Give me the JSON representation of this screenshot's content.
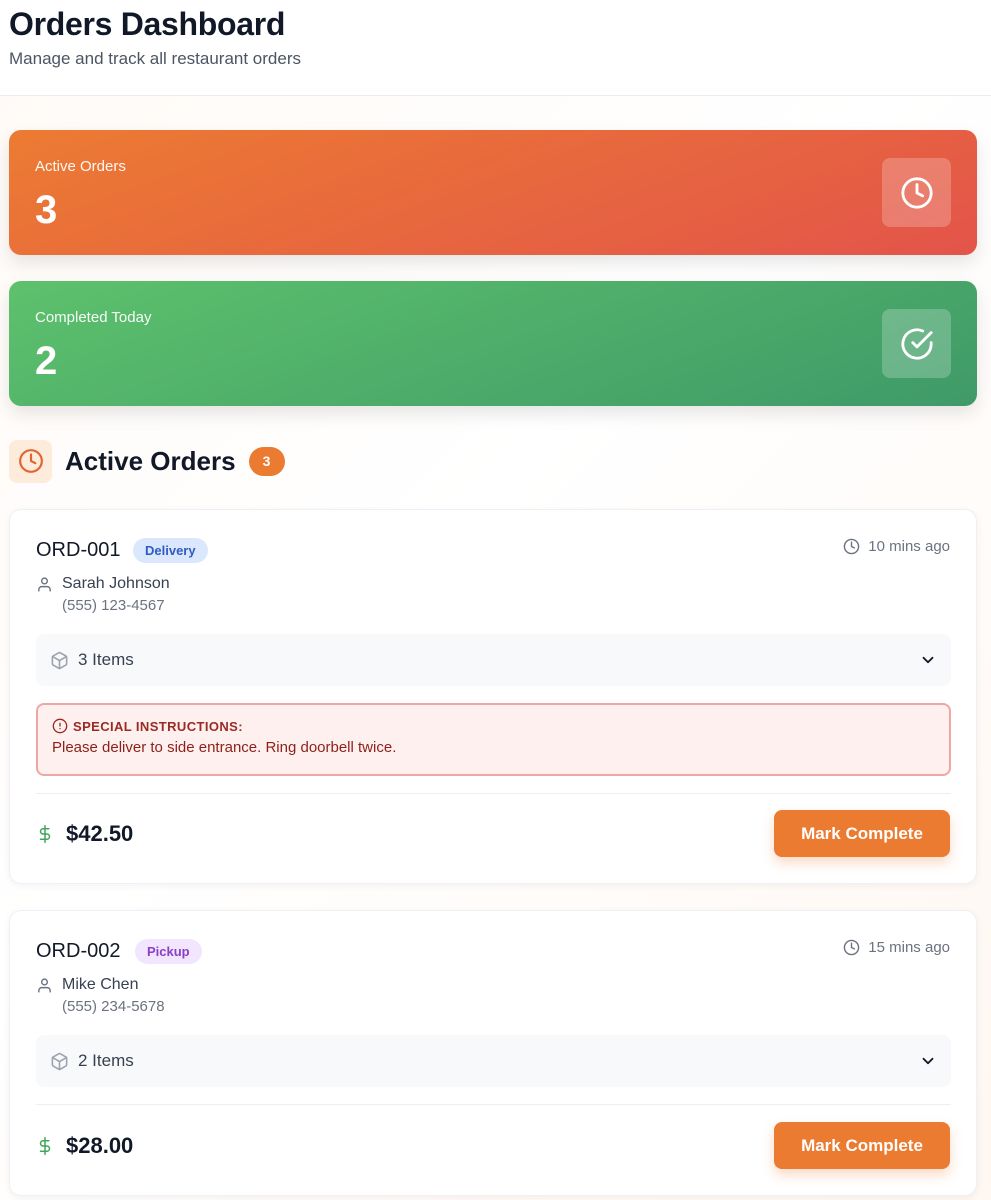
{
  "header": {
    "title": "Orders Dashboard",
    "subtitle": "Manage and track all restaurant orders"
  },
  "stats": [
    {
      "label": "Active Orders",
      "value": "3",
      "icon": "clock-icon",
      "color": "#ec7b32"
    },
    {
      "label": "Completed Today",
      "value": "2",
      "icon": "check-circle-icon",
      "color": "#5dc16c"
    }
  ],
  "section": {
    "title": "Active Orders",
    "count": "3",
    "icon": "clock-icon"
  },
  "orders": [
    {
      "id": "ORD-001",
      "type": "Delivery",
      "time": "10 mins ago",
      "customer": "Sarah Johnson",
      "phone": "(555) 123-4567",
      "items": "3 Items",
      "instructions_label": "SPECIAL INSTRUCTIONS:",
      "instructions": "Please deliver to side entrance. Ring doorbell twice.",
      "price": "$42.50",
      "action": "Mark Complete"
    },
    {
      "id": "ORD-002",
      "type": "Pickup",
      "time": "15 mins ago",
      "customer": "Mike Chen",
      "phone": "(555) 234-5678",
      "items": "2 Items",
      "price": "$28.00",
      "action": "Mark Complete"
    }
  ],
  "colors": {
    "accent": "#ec7b32",
    "success": "#5dc16c",
    "delivery_badge": "#dbe7fd",
    "pickup_badge": "#f1e6fd",
    "alert": "#efa7a3"
  }
}
